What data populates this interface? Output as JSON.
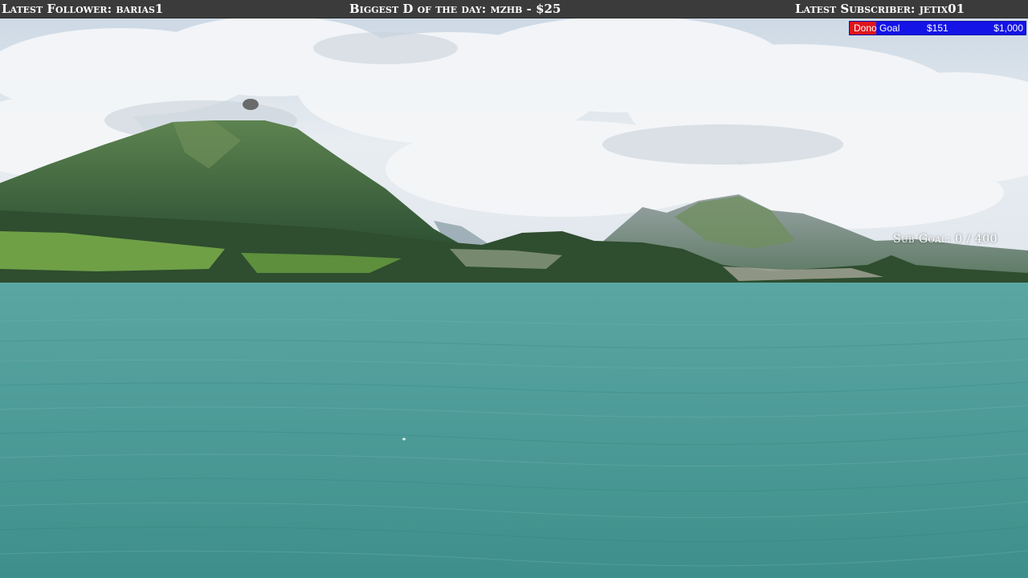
{
  "top_bar": {
    "latest_follower": "Latest Follower: barias1",
    "biggest_donation": "Biggest D of the day: mzhb - $25",
    "latest_subscriber": "Latest Subscriber: jetix01"
  },
  "dono_goal": {
    "label_prefix": "Dono",
    "label_suffix": " Goal",
    "current": "$151",
    "target": "$1,000",
    "progress_fraction": 0.151,
    "fill_color": "#e0161d",
    "bar_color": "#1414e6"
  },
  "sub_goal": {
    "text": "Sub Goal: 0 / 400"
  },
  "scene": {
    "sky_color": "#dfe6ec",
    "water_color": "#4f9d9a",
    "mountain_color": "#3f6a44"
  }
}
